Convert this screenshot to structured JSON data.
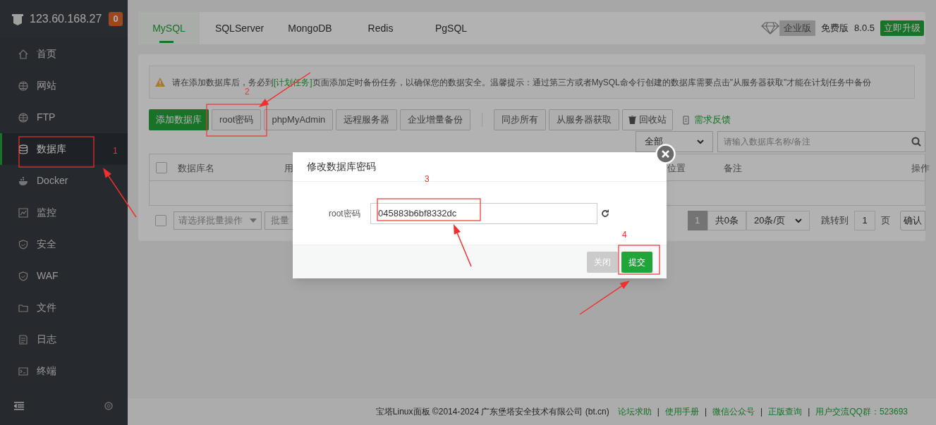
{
  "sidebar": {
    "host": "123.60.168.27",
    "badge": "0",
    "items": [
      {
        "label": "首页",
        "selected": false
      },
      {
        "label": "网站",
        "selected": false
      },
      {
        "label": "FTP",
        "selected": false
      },
      {
        "label": "数据库",
        "selected": true
      },
      {
        "label": "Docker",
        "selected": false
      },
      {
        "label": "监控",
        "selected": false
      },
      {
        "label": "安全",
        "selected": false
      },
      {
        "label": "WAF",
        "selected": false
      },
      {
        "label": "文件",
        "selected": false
      },
      {
        "label": "日志",
        "selected": false
      },
      {
        "label": "终端",
        "selected": false
      }
    ]
  },
  "tabs": [
    {
      "label": "MySQL",
      "selected": true
    },
    {
      "label": "SQLServer",
      "selected": false
    },
    {
      "label": "MongoDB",
      "selected": false
    },
    {
      "label": "Redis",
      "selected": false
    },
    {
      "label": "PgSQL",
      "selected": false
    }
  ],
  "edition": {
    "enterprise": "企业版",
    "free": "免费版",
    "version": "8.0.5",
    "upgrade": "立即升级"
  },
  "alert": {
    "before": "请在添加数据库后，务必到",
    "link": "[计划任务]",
    "after": "页面添加定时备份任务，以确保您的数据安全。温馨提示：通过第三方或者MySQL命令行创建的数据库需要点击\"从服务器获取\"才能在计划任务中备份"
  },
  "toolbar": {
    "primary": "添加数据库",
    "group1": [
      "root密码",
      "phpMyAdmin",
      "远程服务器",
      "企业增量备份"
    ],
    "group2": [
      "同步所有",
      "从服务器获取"
    ],
    "recycle": "回收站",
    "feedback": "需求反馈"
  },
  "filter": {
    "select": "全部",
    "placeholder": "请输入数据库名称/备注"
  },
  "table": {
    "checked": false,
    "columns": [
      "数据库名",
      "用",
      "位置",
      "备注",
      "操作"
    ]
  },
  "batch": {
    "checked": false,
    "select": "请选择批量操作",
    "button": "批量"
  },
  "pagination": {
    "page": "1",
    "total": "共0条",
    "per_page": "20条/页",
    "jump": "跳转到",
    "jump_value": "1",
    "page_unit": "页",
    "confirm": "确认"
  },
  "modal": {
    "title": "修改数据库密码",
    "label": "root密码",
    "value": "045883b6bf8332dc",
    "close": "关闭",
    "submit": "提交"
  },
  "footer": {
    "separator": "|",
    "copyright": "宝塔Linux面板 ©2014-2024 广东堡塔安全技术有限公司 (bt.cn)",
    "links": [
      "论坛求助",
      "使用手册",
      "微信公众号",
      "正版查询",
      "用户交流QQ群：523693"
    ]
  },
  "annotations": [
    {
      "label": "1"
    },
    {
      "label": "2"
    },
    {
      "label": "3"
    },
    {
      "label": "4"
    }
  ]
}
